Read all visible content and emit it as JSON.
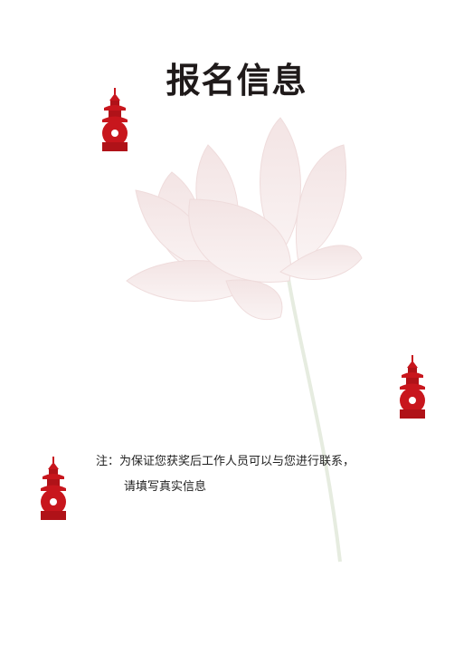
{
  "page": {
    "title": "报名信息",
    "note_line1": "注：为保证您获奖后工作人员可以与您进行联系，",
    "note_line2": "请填写真实信息"
  },
  "colors": {
    "accent_red": "#c8161d",
    "lotus_petal": "#f4e6e6",
    "skyline": "#d24a2e"
  }
}
